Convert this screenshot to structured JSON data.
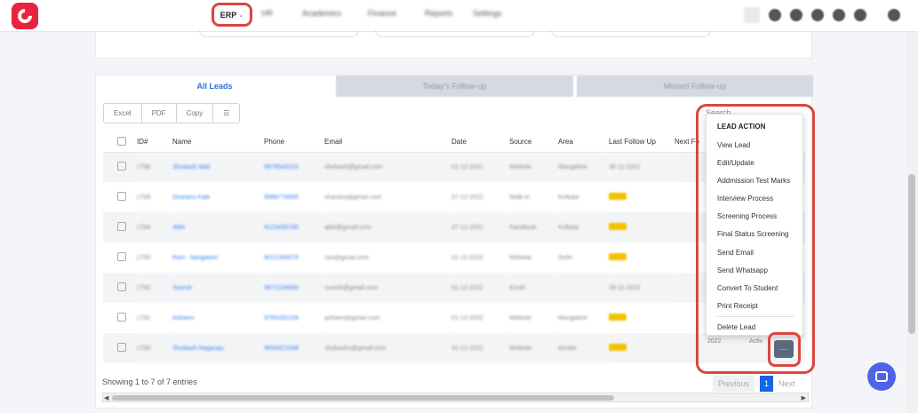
{
  "nav": {
    "erp_label": "ERP",
    "items": [
      "HR",
      "Academics",
      "Finance",
      "Reports",
      "Settings"
    ]
  },
  "tabs": {
    "all_leads": "All Leads",
    "today": "Today's Follow-up",
    "missed": "Missed Follow-up"
  },
  "export_buttons": [
    "Excel",
    "PDF",
    "Copy"
  ],
  "search": {
    "placeholder": "Search..."
  },
  "table": {
    "headers": [
      "ID#",
      "Name",
      "Phone",
      "Email",
      "Date",
      "Source",
      "Area",
      "Last Follow Up",
      "Next Fo"
    ],
    "rows": [
      {
        "id": "LT96",
        "name": "Shubash Mali",
        "phone": "9876543210",
        "email": "shubash@gmail.com",
        "date": "01-12-2022",
        "source": "Website",
        "area": "Mangalore",
        "last": "30-11-2022",
        "tag": false
      },
      {
        "id": "LT95",
        "name": "Sharanu Kale",
        "phone": "9988776655",
        "email": "sharanu@gmail.com",
        "date": "07-12-2022",
        "source": "Walk-In",
        "area": "Kolkata",
        "last": "",
        "tag": true
      },
      {
        "id": "LT94",
        "name": "Abhi",
        "phone": "9123456780",
        "email": "abhi@gmail.com",
        "date": "07-12-2022",
        "source": "Facebook",
        "area": "Kolkata",
        "last": "",
        "tag": true
      },
      {
        "id": "LT93",
        "name": "Ravi - bangalore",
        "phone": "9012345678",
        "email": "ravi@gmail.com",
        "date": "01-12-2022",
        "source": "Website",
        "area": "Delhi",
        "last": "",
        "tag": true
      },
      {
        "id": "LT92",
        "name": "Suresh",
        "phone": "9871234560",
        "email": "suresh@gmail.com",
        "date": "01-12-2022",
        "source": "Email",
        "area": "",
        "last": "28-11-2022",
        "tag": false
      },
      {
        "id": "LT91",
        "name": "Ashwini",
        "phone": "9765432109",
        "email": "ashwini@gmail.com",
        "date": "01-12-2022",
        "source": "Website",
        "area": "Mangalore",
        "last": "",
        "tag": true
      },
      {
        "id": "LT90",
        "name": "Shubash Nagaraju",
        "phone": "9654321098",
        "email": "shubashn@gmail.com",
        "date": "01-12-2022",
        "source": "Website",
        "area": "Kerala",
        "last": "",
        "tag": true
      }
    ],
    "row7_next": "2022",
    "row7_status": "Activ"
  },
  "menu": {
    "title": "LEAD ACTION",
    "items": [
      "View Lead",
      "Edit/Update",
      "Addmission Test Marks",
      "Interview Process",
      "Screening Process",
      "Final Status Screening",
      "Send Email",
      "Send Whatsapp",
      "Convert To Student",
      "Print Receipt"
    ],
    "delete": "Delete Lead",
    "action_glyph": "···"
  },
  "footer": {
    "info": "Showing 1 to 7 of 7 entries",
    "prev": "Previous",
    "page": "1",
    "next": "Next"
  },
  "colors": {
    "accent": "#1565e8",
    "brand": "#e8233e",
    "highlight": "#d9473d"
  }
}
